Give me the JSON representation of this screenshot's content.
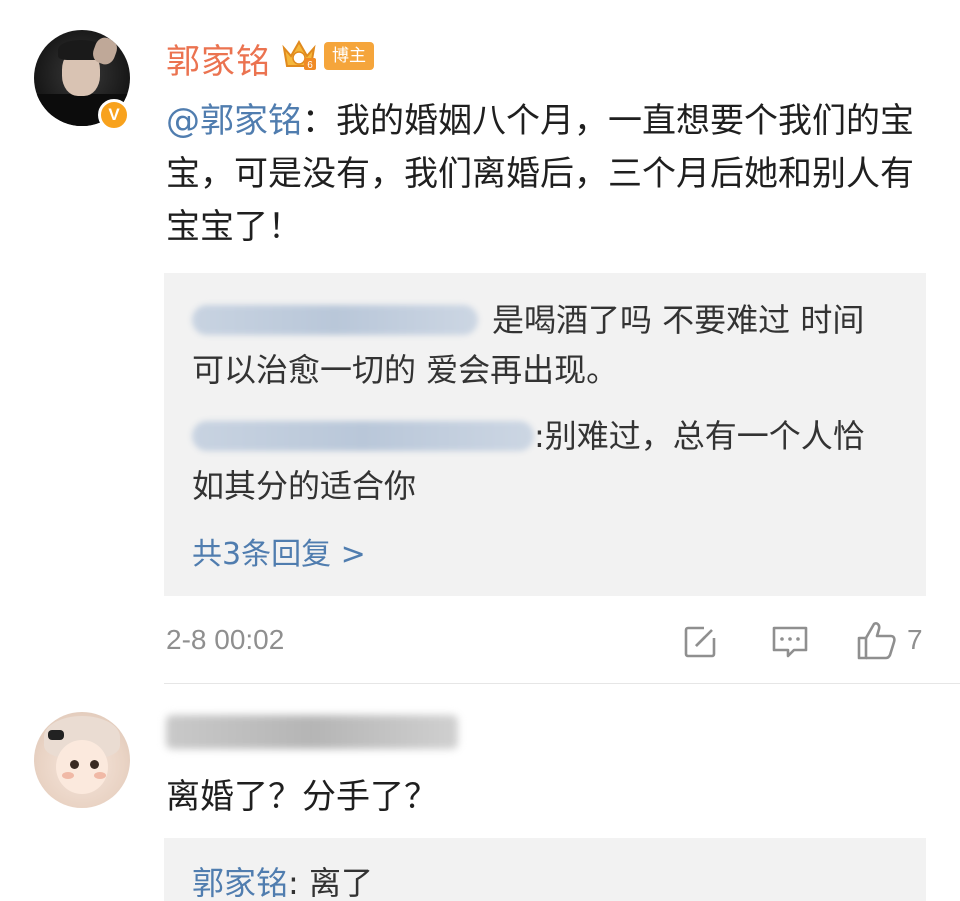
{
  "comments": [
    {
      "author": "郭家铭",
      "author_badge": "博主",
      "verified_mark": "V",
      "mention": "@郭家铭",
      "separator": "：",
      "text": "我的婚姻八个月，一直想要个我们的宝宝，可是没有，我们离婚后，三个月后她和别人有宝宝了！",
      "replies": [
        {
          "text": "是喝酒了吗 不要难过 时间可以治愈一切的 爱会再出现。"
        },
        {
          "text": ":别难过，总有一个人恰如其分的适合你"
        }
      ],
      "more_replies": "共3条回复 >",
      "timestamp": "2-8 00:02",
      "like_count": "7",
      "icons": {
        "share": "share-icon",
        "comment": "comment-icon",
        "like": "thumbs-up-icon",
        "crown": "crown-icon"
      }
    },
    {
      "text": "离婚了？分手了？",
      "reply": {
        "author": "郭家铭",
        "separator": ": ",
        "text": "离了"
      }
    }
  ],
  "colors": {
    "name_orange": "#eb7350",
    "link_blue": "#507daf",
    "badge_orange": "#f5a53b",
    "verified_gold": "#f8a21d",
    "reply_bg": "#f2f2f2",
    "meta_gray": "#8f8f8f"
  }
}
